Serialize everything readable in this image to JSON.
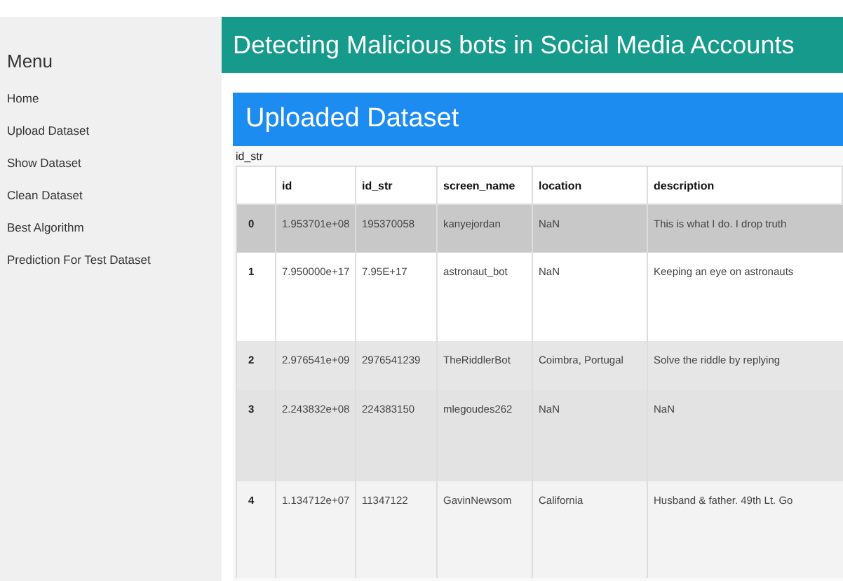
{
  "sidebar": {
    "title": "Menu",
    "items": [
      {
        "label": "Home"
      },
      {
        "label": "Upload Dataset"
      },
      {
        "label": "Show Dataset"
      },
      {
        "label": "Clean Dataset"
      },
      {
        "label": "Best Algorithm"
      },
      {
        "label": "Prediction For Test Dataset"
      }
    ]
  },
  "header": {
    "title": "Detecting Malicious bots in Social Media Accounts"
  },
  "panel": {
    "title": "Uploaded Dataset",
    "caption": "id_str"
  },
  "table": {
    "columns": [
      "",
      "id",
      "id_str",
      "screen_name",
      "location",
      "description"
    ],
    "rows": [
      {
        "cells": [
          "0",
          "1.953701e+08",
          "195370058",
          "kanyejordan",
          "NaN",
          "This is what I do. I drop truth"
        ],
        "selected": true
      },
      {
        "cells": [
          "1",
          "7.950000e+17",
          "7.95E+17",
          "astronaut_bot",
          "NaN",
          "Keeping an eye on astronauts"
        ],
        "selected": false
      },
      {
        "cells": [
          "2",
          "2.976541e+09",
          "2976541239",
          "TheRiddlerBot",
          "Coimbra, Portugal",
          "Solve the riddle by replying"
        ],
        "selected": false
      },
      {
        "cells": [
          "3",
          "2.243832e+08",
          "224383150",
          "mlegoudes262",
          "NaN",
          "NaN"
        ],
        "selected": false
      },
      {
        "cells": [
          "4",
          "1.134712e+07",
          "11347122",
          "GavinNewsom",
          "California",
          "Husband & father. 49th Lt. Go"
        ],
        "selected": false
      }
    ]
  }
}
